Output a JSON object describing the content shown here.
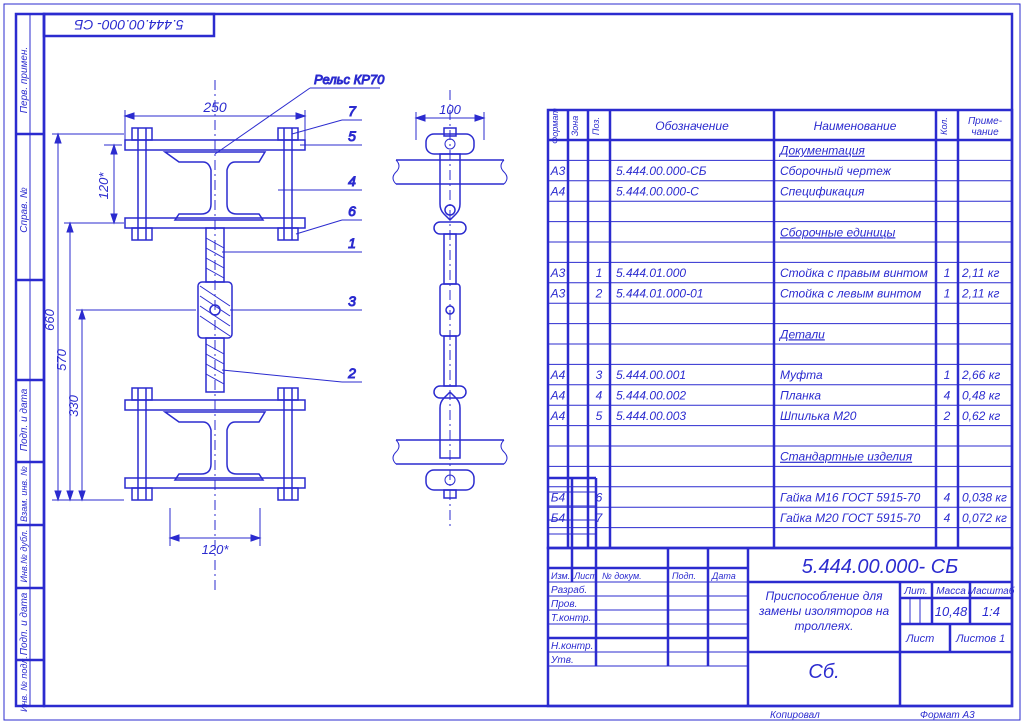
{
  "doc_number_top": "5.444.00.000- СБ",
  "rail_label": "Рельс КР70",
  "dimensions": {
    "w250": "250",
    "w100": "100",
    "h120a": "120*",
    "h120b": "120*",
    "h660": "660",
    "h570": "570",
    "h330": "330"
  },
  "callouts": [
    "1",
    "2",
    "3",
    "4",
    "5",
    "6",
    "7"
  ],
  "bom": {
    "headers": {
      "format": "Формат",
      "zone": "Зона",
      "pos": "Поз.",
      "oboz": "Обозначение",
      "naim": "Наименование",
      "kol": "Кол.",
      "prim": "Приме-\nчание"
    },
    "rows": [
      {
        "f": "",
        "z": "",
        "p": "",
        "o": "",
        "n": "Документация",
        "k": "",
        "pr": "",
        "u": true
      },
      {
        "f": "А3",
        "z": "",
        "p": "",
        "o": "5.444.00.000-СБ",
        "n": "Сборочный чертеж",
        "k": "",
        "pr": ""
      },
      {
        "f": "А4",
        "z": "",
        "p": "",
        "o": "5.444.00.000-С",
        "n": "Спецификация",
        "k": "",
        "pr": ""
      },
      {
        "f": "",
        "z": "",
        "p": "",
        "o": "",
        "n": "",
        "k": "",
        "pr": ""
      },
      {
        "f": "",
        "z": "",
        "p": "",
        "o": "",
        "n": "Сборочные единицы",
        "k": "",
        "pr": "",
        "u": true
      },
      {
        "f": "",
        "z": "",
        "p": "",
        "o": "",
        "n": "",
        "k": "",
        "pr": ""
      },
      {
        "f": "А3",
        "z": "",
        "p": "1",
        "o": "5.444.01.000",
        "n": "Стойка с правым винтом",
        "k": "1",
        "pr": "2,11 кг"
      },
      {
        "f": "А3",
        "z": "",
        "p": "2",
        "o": "5.444.01.000-01",
        "n": "Стойка с левым винтом",
        "k": "1",
        "pr": "2,11 кг"
      },
      {
        "f": "",
        "z": "",
        "p": "",
        "o": "",
        "n": "",
        "k": "",
        "pr": ""
      },
      {
        "f": "",
        "z": "",
        "p": "",
        "o": "",
        "n": "Детали",
        "k": "",
        "pr": "",
        "u": true
      },
      {
        "f": "",
        "z": "",
        "p": "",
        "o": "",
        "n": "",
        "k": "",
        "pr": ""
      },
      {
        "f": "А4",
        "z": "",
        "p": "3",
        "o": "5.444.00.001",
        "n": "Муфта",
        "k": "1",
        "pr": "2,66 кг"
      },
      {
        "f": "А4",
        "z": "",
        "p": "4",
        "o": "5.444.00.002",
        "n": "Планка",
        "k": "4",
        "pr": "0,48 кг"
      },
      {
        "f": "А4",
        "z": "",
        "p": "5",
        "o": "5.444.00.003",
        "n": "Шпилька М20",
        "k": "2",
        "pr": "0,62 кг"
      },
      {
        "f": "",
        "z": "",
        "p": "",
        "o": "",
        "n": "",
        "k": "",
        "pr": ""
      },
      {
        "f": "",
        "z": "",
        "p": "",
        "o": "",
        "n": "Стандартные изделия",
        "k": "",
        "pr": "",
        "u": true
      },
      {
        "f": "",
        "z": "",
        "p": "",
        "o": "",
        "n": "",
        "k": "",
        "pr": ""
      },
      {
        "f": "Б4",
        "z": "",
        "p": "6",
        "o": "",
        "n": "Гайка М16  ГОСТ 5915-70",
        "k": "4",
        "pr": "0,038 кг"
      },
      {
        "f": "Б4",
        "z": "",
        "p": "7",
        "o": "",
        "n": "Гайка М20 ГОСТ 5915-70",
        "k": "4",
        "pr": "0,072 кг"
      }
    ]
  },
  "titleblock": {
    "number": "5.444.00.000- СБ",
    "name_l1": "Приспособление для",
    "name_l2": "замены изоляторов на",
    "name_l3": "троллеях.",
    "type": "Сб.",
    "lit": "Лит.",
    "massa_lbl": "Масса",
    "massa": "10,48",
    "masht_lbl": "Масштаб",
    "masht": "1:4",
    "list": "Лист",
    "listov": "Листов     1",
    "izm": "Изм.",
    "list2": "Лист",
    "ndok": "№ докум.",
    "podp": "Подп.",
    "data": "Дата",
    "razrab": "Разраб.",
    "prov": "Пров.",
    "tkontr": "Т.контр.",
    "nkontr": "Н.контр.",
    "utv": "Утв.",
    "kopiroval": "Копировал",
    "format": "Формат    А3"
  },
  "sidebar": {
    "perv_primen": "Перв. примен.",
    "sprav": "Справ. №",
    "podp_data1": "Подп. и дата",
    "vzam_inv": "Взам. инв. №",
    "inv_dubl": "Инв.№ дубл.",
    "podp_data2": "Подп. и дата",
    "inv_podl": "Инв. № подл."
  }
}
